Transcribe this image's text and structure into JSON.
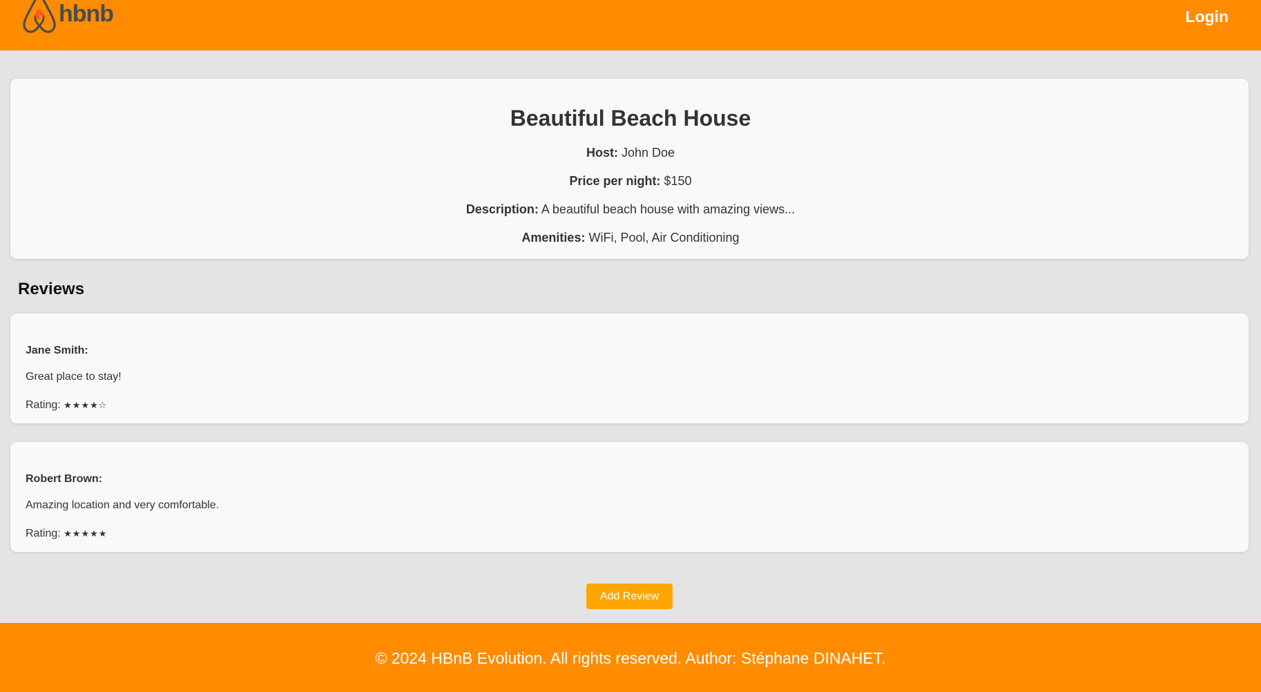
{
  "header": {
    "logo_text": "hbnb",
    "login_label": "Login"
  },
  "place": {
    "title": "Beautiful Beach House",
    "host_label": "Host:",
    "host_value": "John Doe",
    "price_label": "Price per night:",
    "price_value": "$150",
    "description_label": "Description:",
    "description_value": "A beautiful beach house with amazing views...",
    "amenities_label": "Amenities:",
    "amenities_value": "WiFi, Pool, Air Conditioning"
  },
  "reviews": {
    "heading": "Reviews",
    "items": [
      {
        "author": "Jane Smith:",
        "text": "Great place to stay!",
        "rating_label": "Rating:",
        "rating_stars": "★★★★☆",
        "rating_value": 4,
        "rating_max": 5
      },
      {
        "author": "Robert Brown:",
        "text": "Amazing location and very comfortable.",
        "rating_label": "Rating:",
        "rating_stars": "★★★★★",
        "rating_value": 5,
        "rating_max": 5
      }
    ],
    "add_button_label": "Add Review"
  },
  "footer": {
    "text": "© 2024 HBnB Evolution. All rights reserved. Author: Stéphane DINAHET."
  },
  "colors": {
    "brand_orange": "#ff8c00",
    "button_orange": "#ffa500",
    "page_background": "#e4e4e4",
    "card_background": "#f9f9f9",
    "logo_gray": "#4b4b4b",
    "logo_flame": "#ff5a1f"
  },
  "icons": {
    "logo": "airbnb-style-flame-logo-icon"
  }
}
